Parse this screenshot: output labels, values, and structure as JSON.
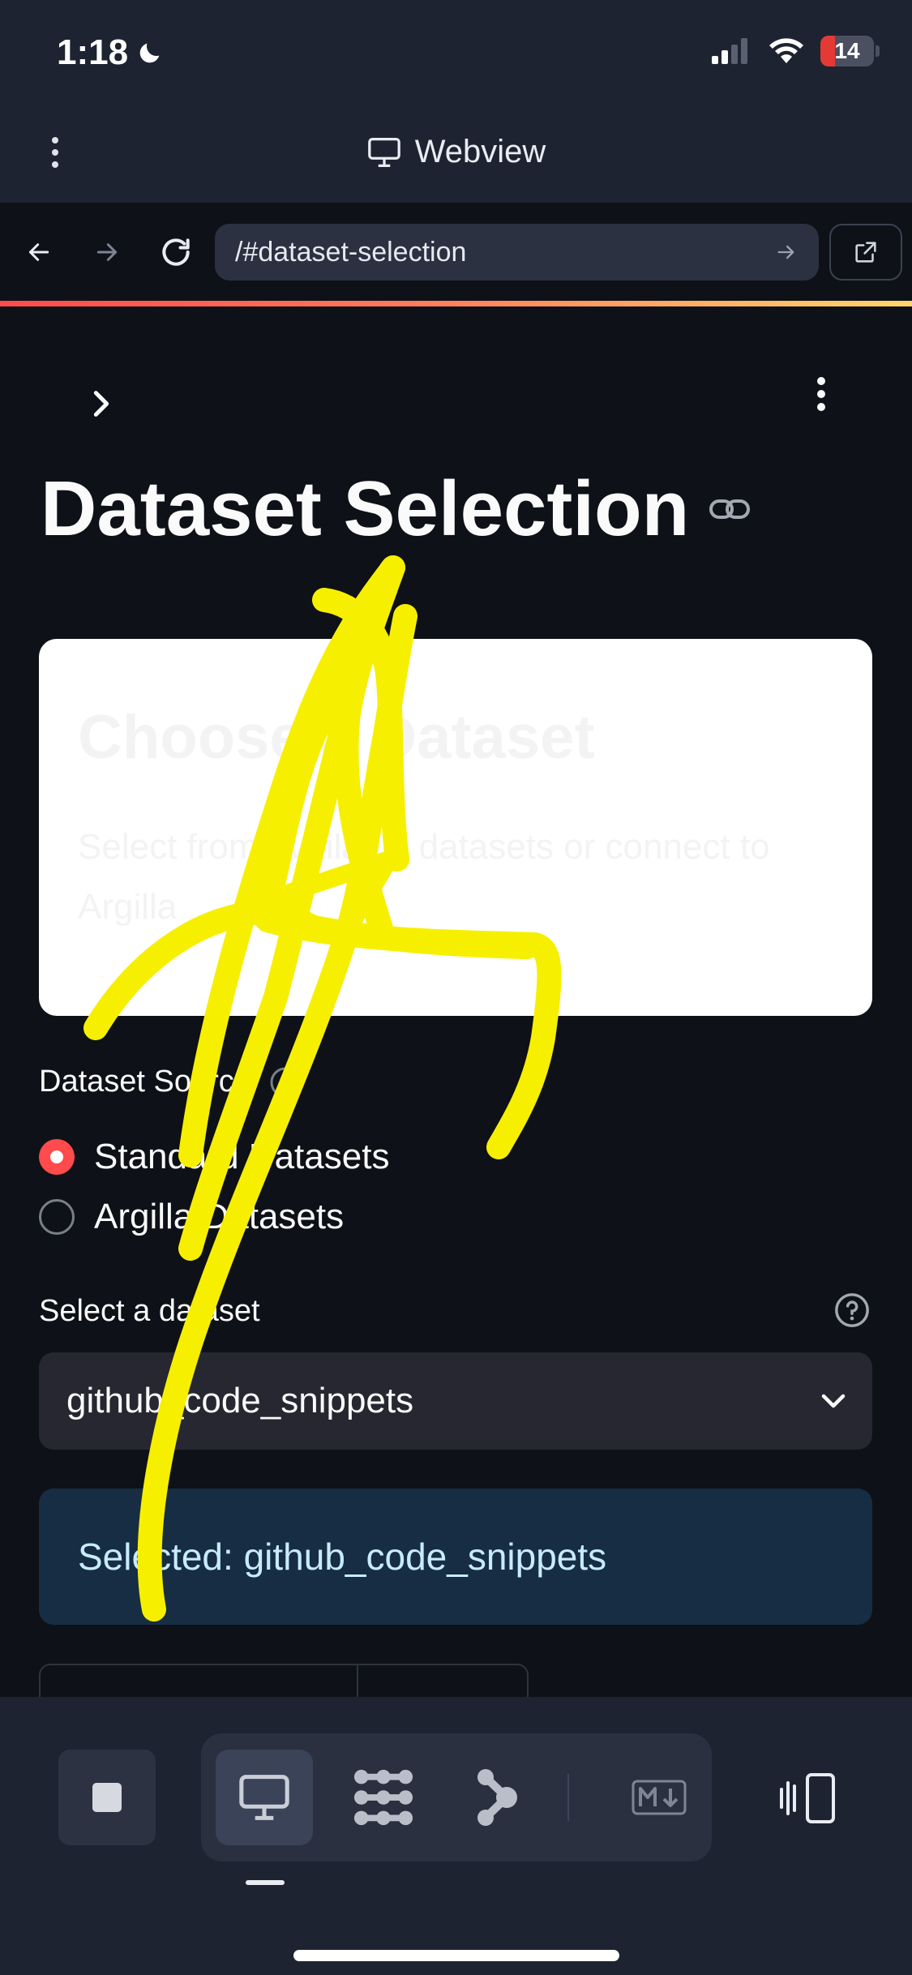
{
  "status_bar": {
    "time": "1:18",
    "battery_level": "14",
    "battery_fraction": 0.14,
    "icons": [
      "moon-icon",
      "cellular-signal-icon",
      "wifi-icon",
      "battery-icon"
    ]
  },
  "header": {
    "title": "Webview",
    "icons": [
      "more-vertical-icon",
      "monitor-icon"
    ]
  },
  "browser_bar": {
    "url": "/#dataset-selection",
    "icons": [
      "back-arrow-icon",
      "forward-arrow-icon",
      "reload-icon",
      "go-arrow-icon",
      "open-external-icon"
    ]
  },
  "page": {
    "title": "Dataset Selection",
    "title_icon": "link-icon",
    "card": {
      "title": "Choose a Dataset",
      "subtitle": "Select from available datasets or connect to Argilla"
    },
    "source": {
      "label": "Dataset Source",
      "options": [
        {
          "label": "Standard Datasets",
          "selected": true
        },
        {
          "label": "Argilla Datasets",
          "selected": false
        }
      ]
    },
    "select": {
      "label": "Select a dataset",
      "value": "github_code_snippets"
    },
    "alert": {
      "text": "Selected: github_code_snippets"
    }
  },
  "annotation": {
    "color": "#f7ef00",
    "shape": "hand-drawn-arrow"
  },
  "toolbar": {
    "items": [
      "stop-icon",
      "monitor-icon",
      "grid-dots-icon",
      "branch-icon",
      "markdown-icon",
      "device-rotate-icon"
    ],
    "active": "monitor-icon"
  },
  "colors": {
    "accent": "#ff4b4b",
    "page_bg": "#0e1117",
    "chrome_bg": "#1d2331",
    "alert_bg": "#172d43",
    "alert_text": "#c7ebff"
  }
}
